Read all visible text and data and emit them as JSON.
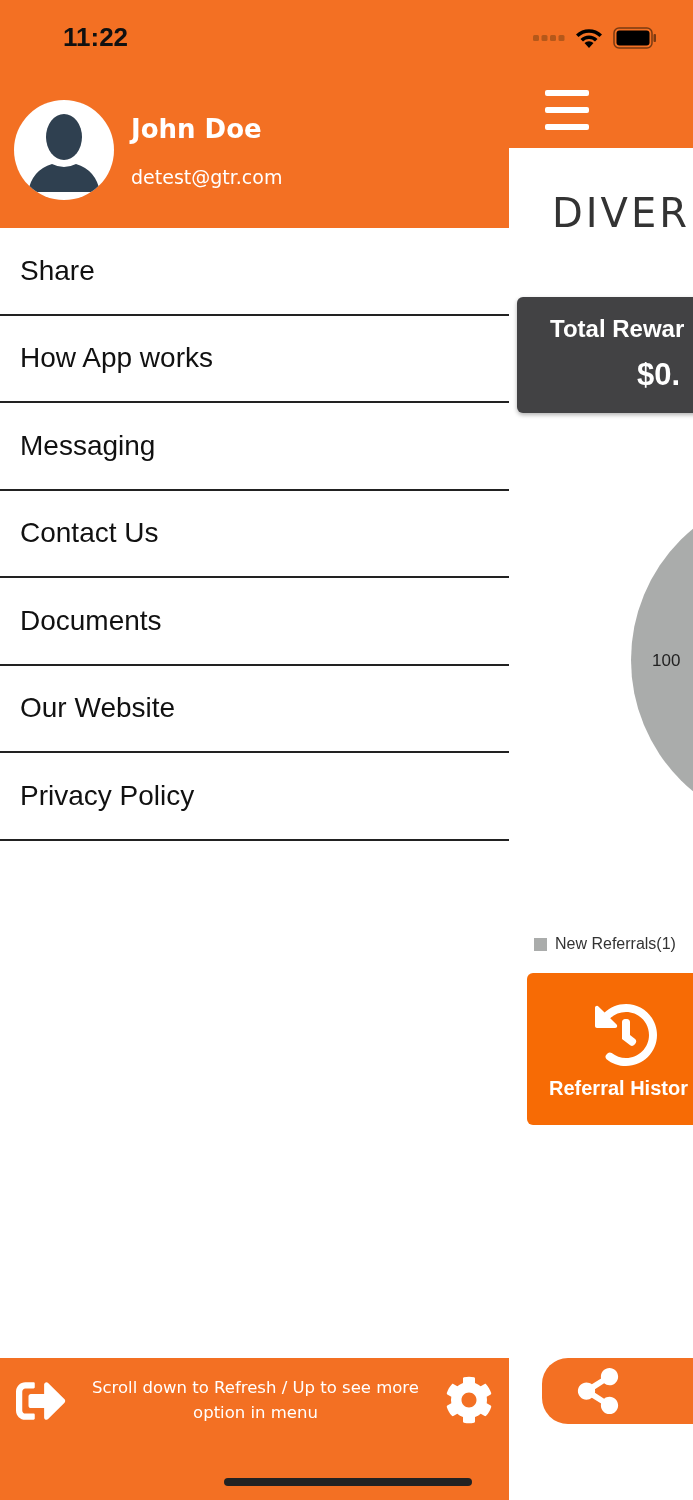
{
  "status_bar": {
    "time": "11:22"
  },
  "drawer": {
    "user": {
      "name": "John Doe",
      "email": "detest@gtr.com"
    },
    "menu": [
      {
        "label": "Share"
      },
      {
        "label": "How App works"
      },
      {
        "label": "Messaging"
      },
      {
        "label": "Contact Us"
      },
      {
        "label": "Documents"
      },
      {
        "label": "Our Website"
      },
      {
        "label": "Privacy Policy"
      }
    ],
    "footer": {
      "hint": "Scroll down to Refresh / Up to see more option in menu"
    }
  },
  "main": {
    "logo": "DIVER",
    "rewards_card": {
      "title": "Total Rewar",
      "amount": "$0."
    },
    "chart": {
      "chart_data": {
        "type": "pie",
        "values": [
          100
        ],
        "data_labels": true
      }
    },
    "legend": [
      {
        "label": "New Referrals(1)",
        "color": "#aaacab"
      }
    ],
    "referral_history_button": {
      "label": "Referral Histor"
    }
  }
}
